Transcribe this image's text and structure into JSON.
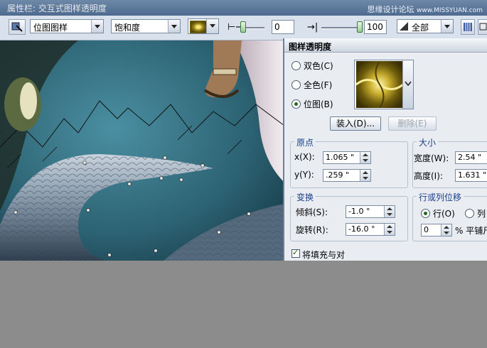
{
  "window": {
    "title": "属性栏:  交互式图样透明度",
    "watermark": "思缘设计论坛",
    "watermark_url": "www.MISSYUAN.com"
  },
  "propbar": {
    "pattern_type": "位图图样",
    "merge_mode": "饱和度",
    "start_value": "0",
    "end_value": "100",
    "target": "全部"
  },
  "docker": {
    "title": "图样透明度",
    "radios": [
      {
        "label": "双色(C)",
        "selected": false
      },
      {
        "label": "全色(F)",
        "selected": false
      },
      {
        "label": "位图(B)",
        "selected": true
      }
    ],
    "load_button": "装入(D)...",
    "delete_button": "删除(E)",
    "origin": {
      "title": "原点",
      "x_label": "x(X):",
      "x_value": "1.065 \"",
      "y_label": "y(Y):",
      "y_value": ".259 \""
    },
    "size": {
      "title": "大小",
      "width_label": "宽度(W):",
      "width_value": "2.54 \"",
      "height_label": "高度(I):",
      "height_value": "1.631 \""
    },
    "transform": {
      "title": "变换",
      "skew_label": "倾斜(S):",
      "skew_value": "-1.0 °",
      "rotate_label": "旋转(R):",
      "rotate_value": "-16.0 °"
    },
    "offset": {
      "title": "行或列位移",
      "row_label": "行(O)",
      "col_label": "列",
      "value": "0",
      "unit": "% 平铺尺"
    },
    "checkbox_label": "将填充与对"
  }
}
